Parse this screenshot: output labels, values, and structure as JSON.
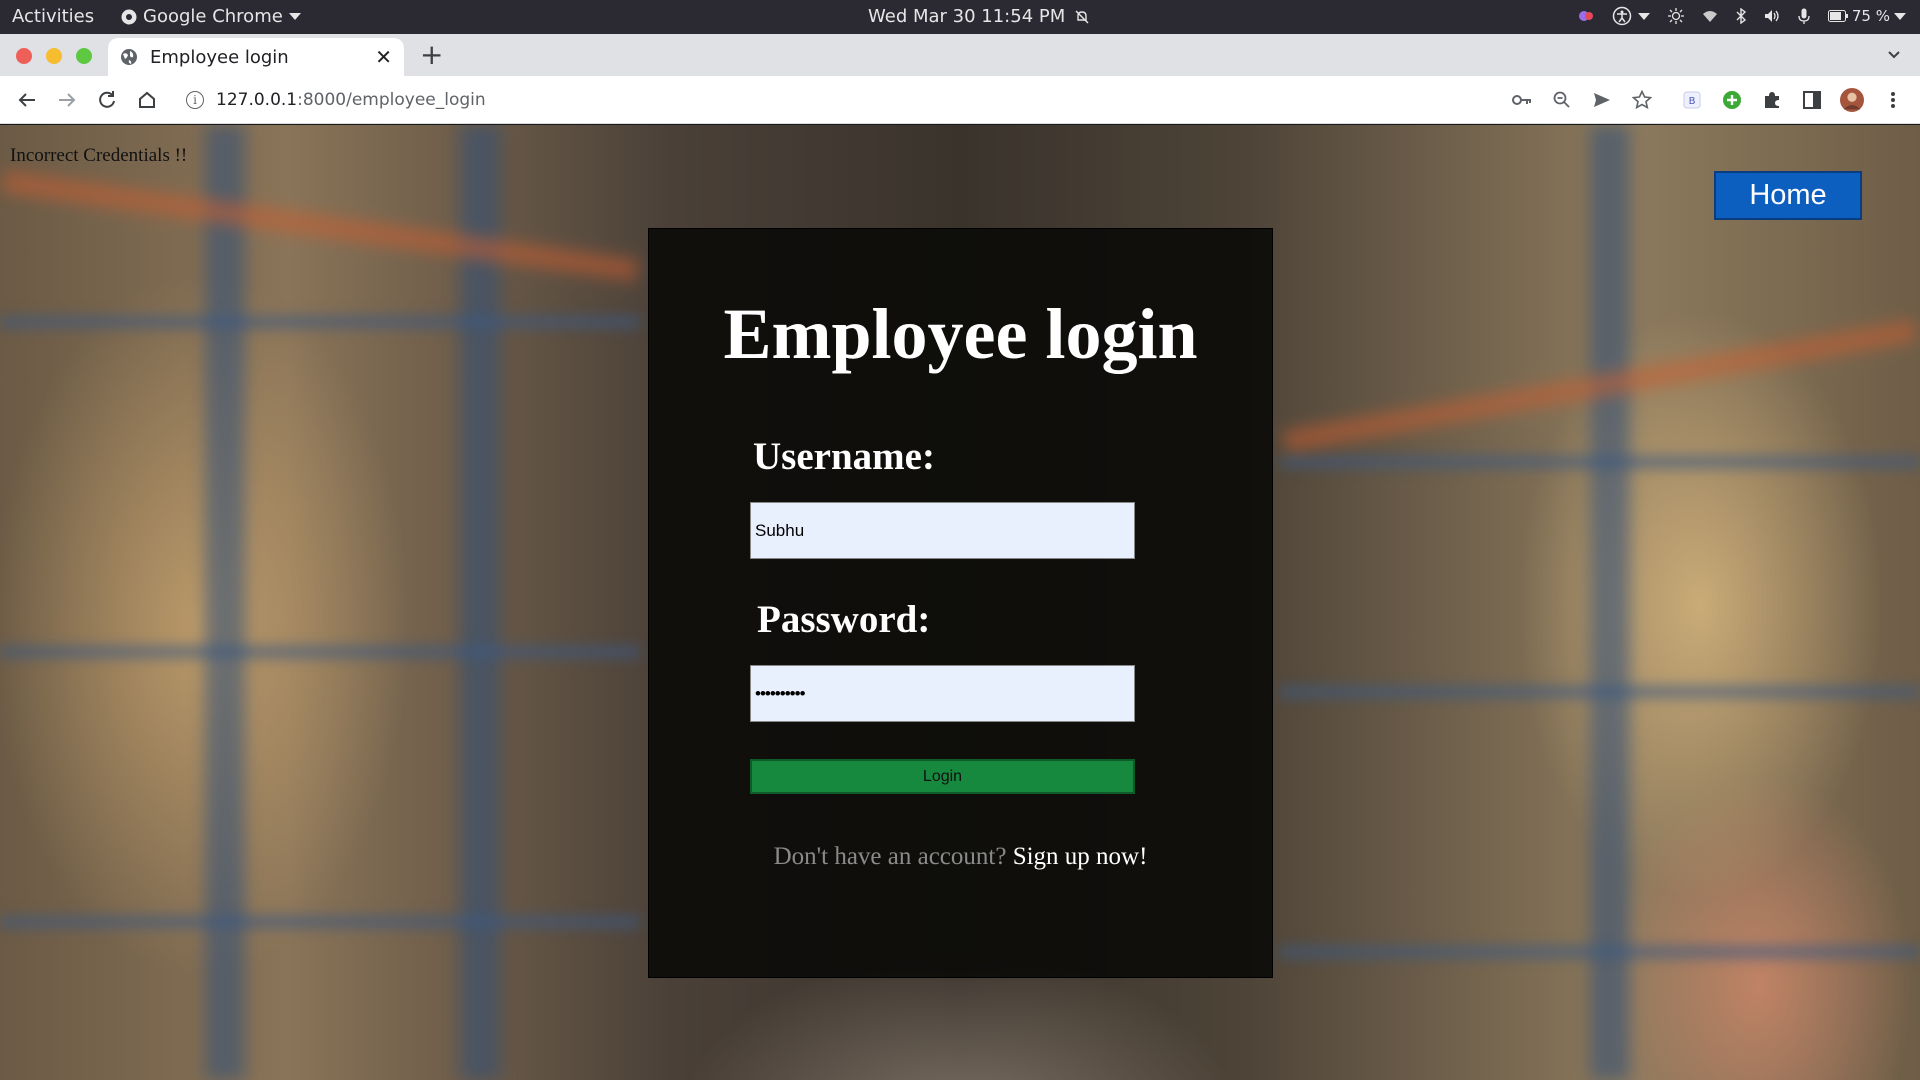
{
  "system_bar": {
    "activities": "Activities",
    "app_name": "Google Chrome",
    "datetime": "Wed Mar 30  11:54 PM",
    "battery": "75 %"
  },
  "browser": {
    "tab_title": "Employee login",
    "url_host": "127.0.0.1",
    "url_path": ":8000/employee_login"
  },
  "page": {
    "error_message": "Incorrect Credentials !!",
    "home_button": "Home",
    "heading": "Employee login",
    "username_label": "Username:",
    "username_value": "Subhu",
    "password_label": "Password:",
    "password_value": "••••••••••",
    "login_button": "Login",
    "signup_prompt": "Don't have an account?",
    "signup_link": "Sign up now!"
  },
  "colors": {
    "card_bg": "#0a0a08",
    "home_button": "#0d5fbf",
    "login_button": "#16893f",
    "input_bg": "#e8f0fe"
  }
}
